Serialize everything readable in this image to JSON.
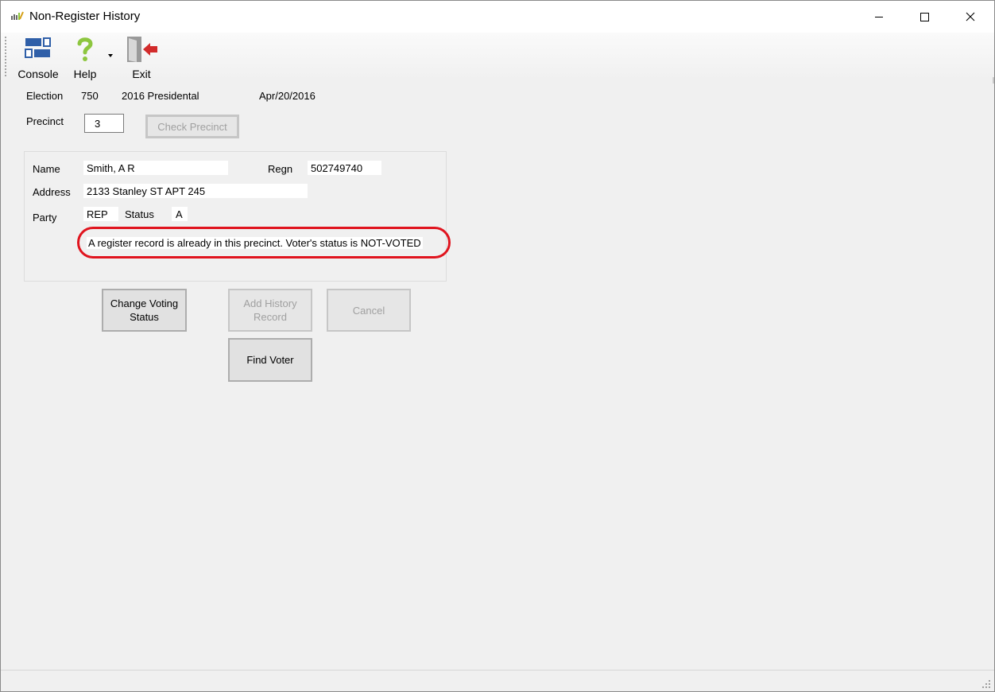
{
  "window": {
    "title": "Non-Register History"
  },
  "toolbar": {
    "console_label": "Console",
    "help_label": "Help",
    "exit_label": "Exit"
  },
  "election": {
    "label": "Election",
    "number": "750",
    "name": "2016 Presidental",
    "date": "Apr/20/2016"
  },
  "precinct": {
    "label": "Precinct",
    "value": "3",
    "check_button": "Check Precinct"
  },
  "voter": {
    "name_label": "Name",
    "name": "Smith, A R",
    "regn_label": "Regn",
    "regn": "502749740",
    "address_label": "Address",
    "address": "2133 Stanley ST APT 245",
    "party_label": "Party",
    "party": "REP",
    "status_label": "Status",
    "status": "A",
    "message": "A register record is already in this precinct.  Voter's status is NOT-VOTED"
  },
  "buttons": {
    "change_voting_status_line1": "Change Voting",
    "change_voting_status_line2": "Status",
    "add_history_line1": "Add History",
    "add_history_line2": "Record",
    "cancel": "Cancel",
    "find_voter": "Find Voter"
  },
  "colors": {
    "highlight_border": "#e0141e",
    "console_icon": "#2f5fa8",
    "help_icon": "#8dc63f",
    "exit_arrow": "#d22b2b"
  }
}
